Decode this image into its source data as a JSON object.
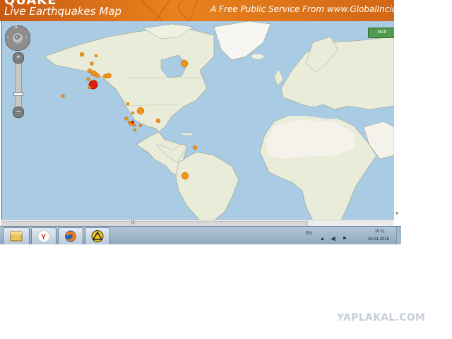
{
  "banner": {
    "logo_fragment": "QUAKE",
    "title": "Live Earthquakes Map",
    "tagline": "A Free Public Service From www.GlobalIncidentM"
  },
  "map": {
    "compass_letter": "N",
    "zoom_in_label": "+",
    "zoom_out_label": "−",
    "zoom_level_fraction": 0.15,
    "map_type_label": "MAP",
    "colors": {
      "ocean": "#a9cbe3",
      "land": "#e9ecd8",
      "desert": "#f4f2ea",
      "quake": "#f09419",
      "quake_major": "#e51c0f"
    },
    "quakes": [
      {
        "region": "alaska",
        "magnitude": "large",
        "color": "#e51c0f"
      },
      {
        "region": "alaska",
        "magnitude": "medium"
      },
      {
        "region": "california",
        "magnitude": "small"
      },
      {
        "region": "central-usa",
        "magnitude": "medium"
      },
      {
        "region": "hudson-bay",
        "magnitude": "medium"
      },
      {
        "region": "colombia",
        "magnitude": "small"
      },
      {
        "region": "peru",
        "magnitude": "medium"
      }
    ]
  },
  "taskbar": {
    "items": [
      {
        "name": "explorer-icon"
      },
      {
        "name": "yandex-browser-icon"
      },
      {
        "name": "firefox-icon"
      },
      {
        "name": "app-triangle-icon"
      }
    ],
    "language": "EN",
    "tray": [
      "▲",
      "◀)",
      "⚑",
      "▣"
    ],
    "time": "10:11",
    "date": "26.01.2018"
  },
  "watermark": "YAPLAKAL.COM"
}
